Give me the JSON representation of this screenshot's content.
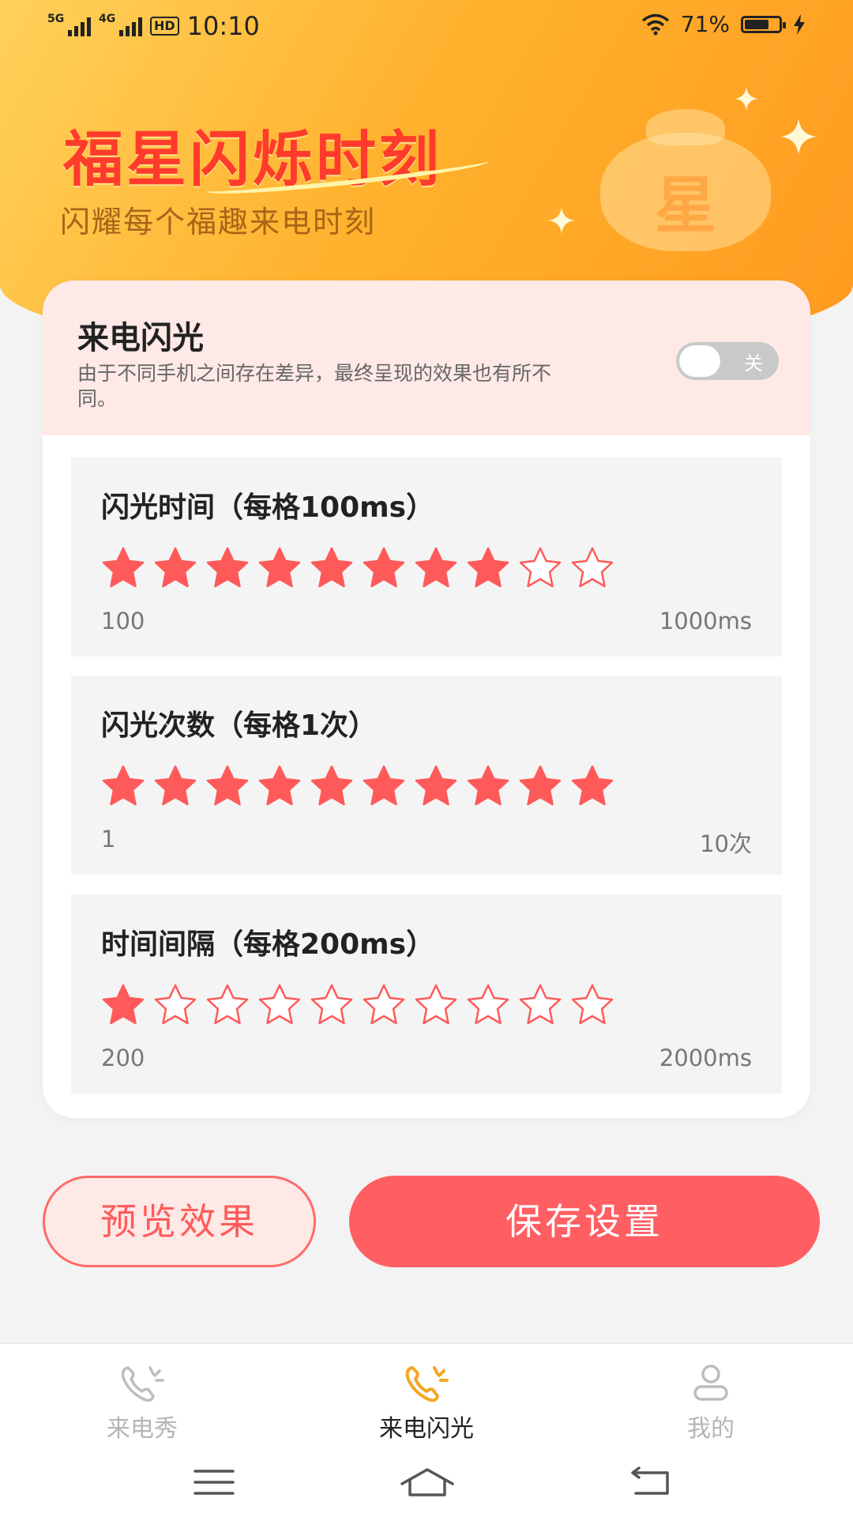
{
  "status": {
    "sim1": "5G",
    "sim2": "4G",
    "hd": "HD",
    "time": "10:10",
    "battery_percent": "71%",
    "battery_level": 0.71
  },
  "banner": {
    "title": "福星闪烁时刻",
    "subtitle": "闪耀每个福趣来电时刻",
    "bag_char": "星"
  },
  "flash": {
    "title": "来电闪光",
    "description": "由于不同手机之间存在差异，最终呈现的效果也有所不同。",
    "toggle_label": "关",
    "toggle_on": false
  },
  "panels": [
    {
      "title": "闪光时间（每格100ms）",
      "min": "100",
      "max": "1000ms",
      "rating": 8,
      "total": 10
    },
    {
      "title": "闪光次数（每格1次）",
      "min": "1",
      "max": "10次",
      "rating": 10,
      "total": 10
    },
    {
      "title": "时间间隔（每格200ms）",
      "min": "200",
      "max": "2000ms",
      "rating": 1,
      "total": 10
    }
  ],
  "buttons": {
    "preview": "预览效果",
    "save": "保存设置"
  },
  "nav": {
    "items": [
      {
        "label": "来电秀",
        "icon": "phone-icon",
        "active": false
      },
      {
        "label": "来电闪光",
        "icon": "phone-flash-icon",
        "active": true
      },
      {
        "label": "我的",
        "icon": "user-icon",
        "active": false
      }
    ]
  },
  "colors": {
    "accent": "#ff5f63",
    "star_filled": "#ff5a5a",
    "nav_active_icon": "#f5a623",
    "header_gradient": [
      "#ffd15a",
      "#ff9a1f"
    ]
  }
}
